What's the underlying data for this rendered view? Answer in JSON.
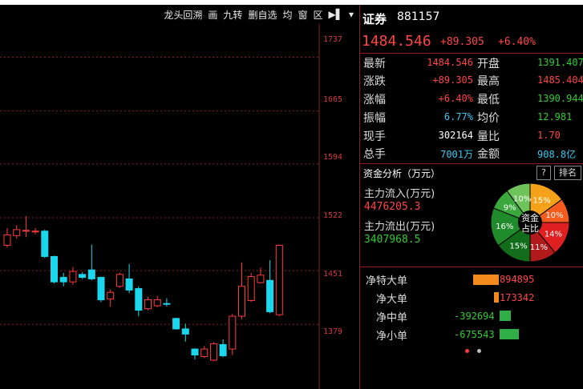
{
  "toolbar": {
    "items": [
      "龙头回溯",
      "画",
      "九转",
      "删自选",
      "均",
      "窗",
      "区"
    ]
  },
  "chart": {
    "price_ticks": [
      "1737",
      "1665",
      "1594",
      "1522",
      "1451",
      "1379"
    ],
    "colors": {
      "up": "#ff3b3b",
      "down": "#1ad7ee",
      "grid": "#8a1f1f"
    }
  },
  "chart_data": {
    "type": "candlestick",
    "ylim": [
      1330,
      1760
    ],
    "y_ticks": [
      1737,
      1665,
      1594,
      1522,
      1451,
      1379
    ],
    "candles": [
      {
        "o": 1485,
        "c": 1499,
        "h": 1508,
        "l": 1482
      },
      {
        "o": 1498,
        "c": 1506,
        "h": 1512,
        "l": 1494
      },
      {
        "o": 1504,
        "c": 1505,
        "h": 1524,
        "l": 1496
      },
      {
        "o": 1503,
        "c": 1504,
        "h": 1508,
        "l": 1500
      },
      {
        "o": 1504,
        "c": 1470,
        "h": 1506,
        "l": 1468
      },
      {
        "o": 1470,
        "c": 1436,
        "h": 1471,
        "l": 1434
      },
      {
        "o": 1442,
        "c": 1436,
        "h": 1448,
        "l": 1430
      },
      {
        "o": 1436,
        "c": 1450,
        "h": 1456,
        "l": 1432
      },
      {
        "o": 1446,
        "c": 1442,
        "h": 1449,
        "l": 1440
      },
      {
        "o": 1452,
        "c": 1440,
        "h": 1486,
        "l": 1438
      },
      {
        "o": 1442,
        "c": 1412,
        "h": 1443,
        "l": 1409
      },
      {
        "o": 1413,
        "c": 1422,
        "h": 1426,
        "l": 1403
      },
      {
        "o": 1430,
        "c": 1446,
        "h": 1448,
        "l": 1428
      },
      {
        "o": 1440,
        "c": 1425,
        "h": 1460,
        "l": 1421
      },
      {
        "o": 1427,
        "c": 1398,
        "h": 1430,
        "l": 1390
      },
      {
        "o": 1400,
        "c": 1412,
        "h": 1416,
        "l": 1398
      },
      {
        "o": 1404,
        "c": 1412,
        "h": 1417,
        "l": 1402
      },
      {
        "o": 1407,
        "c": 1406,
        "h": 1414,
        "l": 1403
      },
      {
        "o": 1387,
        "c": 1373,
        "h": 1388,
        "l": 1372
      },
      {
        "o": 1373,
        "c": 1366,
        "h": 1380,
        "l": 1356
      },
      {
        "o": 1346,
        "c": 1338,
        "h": 1347,
        "l": 1332
      },
      {
        "o": 1336,
        "c": 1346,
        "h": 1350,
        "l": 1334
      },
      {
        "o": 1331,
        "c": 1353,
        "h": 1355,
        "l": 1330
      },
      {
        "o": 1352,
        "c": 1337,
        "h": 1359,
        "l": 1335
      },
      {
        "o": 1346,
        "c": 1390,
        "h": 1393,
        "l": 1338
      },
      {
        "o": 1390,
        "c": 1430,
        "h": 1462,
        "l": 1386
      },
      {
        "o": 1411,
        "c": 1443,
        "h": 1448,
        "l": 1409
      },
      {
        "o": 1435,
        "c": 1445,
        "h": 1455,
        "l": 1434
      },
      {
        "o": 1438,
        "c": 1396,
        "h": 1465,
        "l": 1394
      },
      {
        "o": 1392,
        "c": 1485,
        "h": 1486,
        "l": 1390
      }
    ]
  },
  "header": {
    "name": "证券",
    "code": "881157",
    "price": "1484.546",
    "change": "+89.305",
    "pct": "+6.40%"
  },
  "quote": [
    {
      "k1": "最新",
      "v1": "1484.546",
      "c1": "red",
      "k2": "开盘",
      "v2": "1391.407",
      "c2": "green"
    },
    {
      "k1": "涨跌",
      "v1": "+89.305",
      "c1": "red",
      "k2": "最高",
      "v2": "1485.404",
      "c2": "red"
    },
    {
      "k1": "涨幅",
      "v1": "+6.40%",
      "c1": "red",
      "k2": "最低",
      "v2": "1390.944",
      "c2": "green"
    },
    {
      "k1": "振幅",
      "v1": "6.77%",
      "c1": "cyan",
      "k2": "均价",
      "v2": "12.981",
      "c2": "green"
    },
    {
      "k1": "现手",
      "v1": "302164",
      "c1": "white",
      "k2": "量比",
      "v2": "1.70",
      "c2": "red"
    },
    {
      "k1": "总手",
      "v1": "7001万",
      "c1": "cyan",
      "k2": "金额",
      "v2": "908.8亿",
      "c2": "cyan"
    }
  ],
  "funds": {
    "title": "资金分析（万元）",
    "help": "?",
    "rank": "排名",
    "inflow_label": "主力流入(万元)",
    "inflow_value": "4476205.3",
    "outflow_label": "主力流出(万元)",
    "outflow_value": "3407968.5",
    "pie_center": [
      "资金",
      "占比"
    ],
    "pie": [
      {
        "pct": 15,
        "label": "15%",
        "color": "#f4a21a"
      },
      {
        "pct": 10,
        "label": "10%",
        "color": "#f45b1c"
      },
      {
        "pct": 14,
        "label": "14%",
        "color": "#e02020"
      },
      {
        "pct": 11,
        "label": "11%",
        "color": "#b01a1a"
      },
      {
        "pct": 15,
        "label": "15%",
        "color": "#116d1c"
      },
      {
        "pct": 16,
        "label": "16%",
        "color": "#1f8b2a"
      },
      {
        "pct": 9,
        "label": "9%",
        "color": "#3aa83c"
      },
      {
        "pct": 10,
        "label": "10%",
        "color": "#6ec45a"
      }
    ]
  },
  "orders": [
    {
      "label": "净特大单",
      "value": "894895",
      "sign": "pos",
      "magnitude": 894895
    },
    {
      "label": "净大单",
      "value": "173342",
      "sign": "pos",
      "magnitude": 173342
    },
    {
      "label": "净中单",
      "value": "-392694",
      "sign": "neg",
      "magnitude": 392694
    },
    {
      "label": "净小单",
      "value": "-675543",
      "sign": "neg",
      "magnitude": 675543
    }
  ]
}
